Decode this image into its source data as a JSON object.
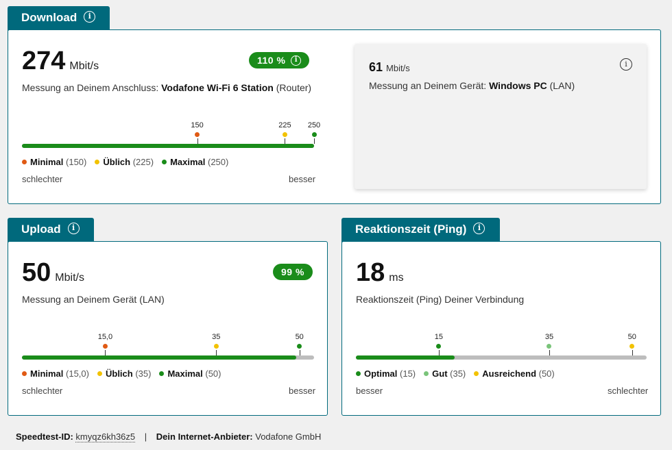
{
  "colors": {
    "teal": "#00697c",
    "green": "#1a8c1a",
    "orange": "#e05a14",
    "yellow": "#f2c200",
    "lightgreen": "#7ac47a",
    "gray": "#bdbdbd"
  },
  "download": {
    "title": "Download",
    "value": "274",
    "unit": "Mbit/s",
    "badge": "110 %",
    "desc_prefix": "Messung an Deinem Anschluss:",
    "device": "Vodafone Wi-Fi 6 Station",
    "device_suffix": "(Router)",
    "progress": 1.0,
    "ticks": [
      {
        "label": "150",
        "pos": 0.6,
        "color": "orange"
      },
      {
        "label": "225",
        "pos": 0.9,
        "color": "yellow"
      },
      {
        "label": "250",
        "pos": 1.0,
        "color": "green"
      }
    ],
    "legend": [
      {
        "name": "Minimal",
        "value": "(150)",
        "color": "orange"
      },
      {
        "name": "Üblich",
        "value": "(225)",
        "color": "yellow"
      },
      {
        "name": "Maximal",
        "value": "(250)",
        "color": "green"
      }
    ],
    "scale_left": "schlechter",
    "scale_right": "besser",
    "pc": {
      "value": "61",
      "unit": "Mbit/s",
      "desc_prefix": "Messung an Deinem Gerät:",
      "device": "Windows PC",
      "device_suffix": "(LAN)"
    }
  },
  "upload": {
    "title": "Upload",
    "value": "50",
    "unit": "Mbit/s",
    "badge": "99 %",
    "desc": "Messung an Deinem Gerät (LAN)",
    "progress": 0.94,
    "ticks": [
      {
        "label": "15,0",
        "pos": 0.285,
        "color": "orange"
      },
      {
        "label": "35",
        "pos": 0.665,
        "color": "yellow"
      },
      {
        "label": "50",
        "pos": 0.95,
        "color": "green"
      }
    ],
    "legend": [
      {
        "name": "Minimal",
        "value": "(15,0)",
        "color": "orange"
      },
      {
        "name": "Üblich",
        "value": "(35)",
        "color": "yellow"
      },
      {
        "name": "Maximal",
        "value": "(50)",
        "color": "green"
      }
    ],
    "scale_left": "schlechter",
    "scale_right": "besser"
  },
  "ping": {
    "title": "Reaktionszeit (Ping)",
    "value": "18",
    "unit": "ms",
    "desc": "Reaktionszeit (Ping) Deiner Verbindung",
    "progress": 0.34,
    "ticks": [
      {
        "label": "15",
        "pos": 0.285,
        "color": "green"
      },
      {
        "label": "35",
        "pos": 0.665,
        "color": "lightgreen"
      },
      {
        "label": "50",
        "pos": 0.95,
        "color": "yellow"
      }
    ],
    "legend": [
      {
        "name": "Optimal",
        "value": "(15)",
        "color": "green"
      },
      {
        "name": "Gut",
        "value": "(35)",
        "color": "lightgreen"
      },
      {
        "name": "Ausreichend",
        "value": "(50)",
        "color": "yellow"
      }
    ],
    "scale_left": "besser",
    "scale_right": "schlechter"
  },
  "footer": {
    "id_label": "Speedtest-ID:",
    "id_value": "kmyqz6kh36z5",
    "separator": "|",
    "provider_label": "Dein Internet-Anbieter:",
    "provider_value": "Vodafone GmbH"
  }
}
